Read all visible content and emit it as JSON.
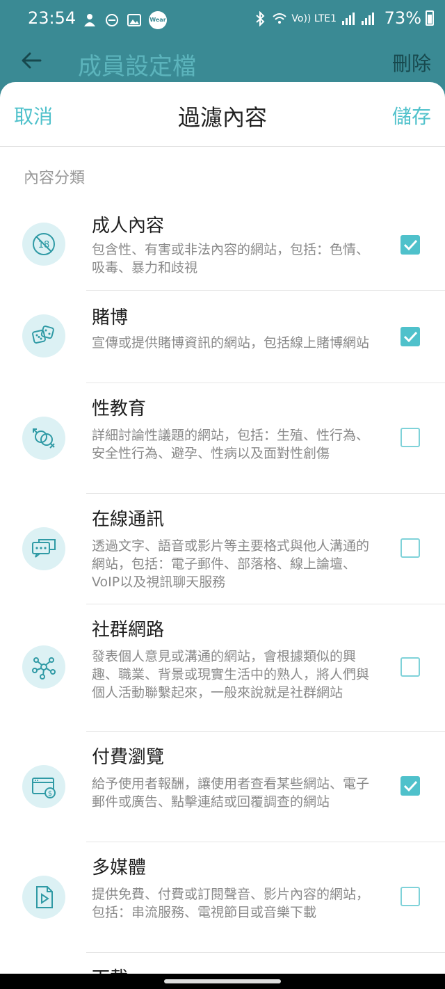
{
  "status_bar": {
    "time": "23:54",
    "battery": "73%",
    "wear_label": "Wear",
    "network_label": "Vo)) LTE1"
  },
  "background_header": {
    "title": "成員設定檔",
    "delete_label": "刪除"
  },
  "sheet": {
    "cancel_label": "取消",
    "title": "過濾內容",
    "save_label": "儲存",
    "section_label": "內容分類"
  },
  "categories": [
    {
      "icon": "age-18-restricted-icon",
      "name": "成人內容",
      "desc": "包含性、有害或非法內容的網站，包括：色情、吸毒、暴力和歧視",
      "checked": true
    },
    {
      "icon": "dice-icon",
      "name": "賭博",
      "desc": "宣傳或提供賭博資訊的網站，包括線上賭博網站",
      "checked": true
    },
    {
      "icon": "gender-symbol-icon",
      "name": "性教育",
      "desc": "詳細討論性議題的網站，包括：生殖、性行為、安全性行為、避孕、性病以及面對性創傷",
      "checked": false
    },
    {
      "icon": "chat-bubbles-icon",
      "name": "在線通訊",
      "desc": "透過文字、語音或影片等主要格式與他人溝通的網站，包括：電子郵件、部落格、線上論壇、VoIP以及視訊聊天服務",
      "checked": false
    },
    {
      "icon": "social-network-icon",
      "name": "社群網路",
      "desc": "發表個人意見或溝通的網站，會根據類似的興趣、職業、背景或現實生活中的熟人，將人們與個人活動聯繫起來，一般來說就是社群網站",
      "checked": false
    },
    {
      "icon": "paid-browser-icon",
      "name": "付費瀏覽",
      "desc": "給予使用者報酬，讓使用者查看某些網站、電子郵件或廣告、點擊連結或回覆調查的網站",
      "checked": true
    },
    {
      "icon": "media-play-icon",
      "name": "多媒體",
      "desc": "提供免費、付費或訂閱聲音、影片內容的網站，包括：串流服務、電視節目或音樂下載",
      "checked": false
    },
    {
      "icon": "download-icon",
      "name": "下載",
      "desc": "",
      "checked": false
    }
  ],
  "colors": {
    "teal_dark": "#3a8a94",
    "accent": "#4fc1cb",
    "icon_bg": "#dcf1f4"
  }
}
